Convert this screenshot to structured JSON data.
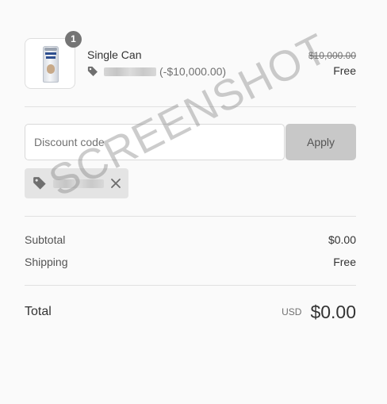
{
  "line_item": {
    "quantity": "1",
    "product_name": "Single Can",
    "discount_amount": "(-$10,000.00)",
    "original_price": "$10,000.00",
    "final_price": "Free",
    "product_image": "beverage-can"
  },
  "discount_form": {
    "placeholder": "Discount code",
    "apply_label": "Apply"
  },
  "applied_discount": {
    "remove_icon": "close-icon",
    "tag_icon": "tag-icon"
  },
  "summary": {
    "subtotal_label": "Subtotal",
    "subtotal_value": "$0.00",
    "shipping_label": "Shipping",
    "shipping_value": "Free"
  },
  "total": {
    "label": "Total",
    "currency": "USD",
    "amount": "$0.00"
  },
  "watermark": "SCREENSHOT",
  "colors": {
    "background": "#fafafa",
    "apply_button": "#c8c8c8",
    "quantity_badge": "#757575",
    "chip_background": "#e4e4e4"
  }
}
